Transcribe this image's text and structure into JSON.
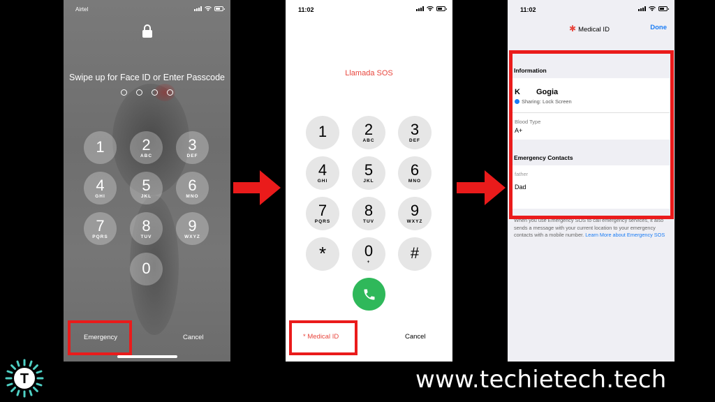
{
  "lock_screen": {
    "carrier": "Airtel",
    "prompt": "Swipe up for Face ID or Enter Passcode",
    "keys": [
      {
        "digit": "1",
        "letters": ""
      },
      {
        "digit": "2",
        "letters": "ABC"
      },
      {
        "digit": "3",
        "letters": "DEF"
      },
      {
        "digit": "4",
        "letters": "GHI"
      },
      {
        "digit": "5",
        "letters": "JKL"
      },
      {
        "digit": "6",
        "letters": "MNO"
      },
      {
        "digit": "7",
        "letters": "PQRS"
      },
      {
        "digit": "8",
        "letters": "TUV"
      },
      {
        "digit": "9",
        "letters": "WXYZ"
      },
      {
        "digit": "0",
        "letters": ""
      }
    ],
    "emergency_label": "Emergency",
    "cancel_label": "Cancel"
  },
  "dialer": {
    "time": "11:02",
    "title": "Llamada SOS",
    "keys": [
      {
        "digit": "1",
        "letters": ""
      },
      {
        "digit": "2",
        "letters": "ABC"
      },
      {
        "digit": "3",
        "letters": "DEF"
      },
      {
        "digit": "4",
        "letters": "GHI"
      },
      {
        "digit": "5",
        "letters": "JKL"
      },
      {
        "digit": "6",
        "letters": "MNO"
      },
      {
        "digit": "7",
        "letters": "PQRS"
      },
      {
        "digit": "8",
        "letters": "TUV"
      },
      {
        "digit": "9",
        "letters": "WXYZ"
      },
      {
        "digit": "*",
        "letters": ""
      },
      {
        "digit": "0",
        "letters": "+"
      },
      {
        "digit": "#",
        "letters": ""
      }
    ],
    "medical_id_label": "* Medical ID",
    "cancel_label": "Cancel",
    "call_icon": "phone-icon"
  },
  "medical_id": {
    "time": "11:02",
    "title": "Medical ID",
    "done_label": "Done",
    "information_header": "Information",
    "name": "K Gogia",
    "sharing": "Sharing: Lock Screen",
    "blood_type_label": "Blood Type",
    "blood_type": "A+",
    "emergency_contacts_header": "Emergency Contacts",
    "contact_relation": "father",
    "contact_name": "Dad",
    "footer_text": "When you use Emergency SOS to call emergency services, it also sends a message with your current location to your emergency contacts with a mobile number.",
    "footer_link": "Learn More about Emergency SOS"
  },
  "branding": {
    "website": "www.techietech.tech",
    "logo_letter": "T"
  },
  "colors": {
    "highlight": "#ea1b1b",
    "arrow": "#ea1b1b",
    "sos_red": "#e8453c",
    "call_green": "#2fb85a",
    "link_blue": "#1a7cf5",
    "logo_teal": "#4fd1c5"
  }
}
